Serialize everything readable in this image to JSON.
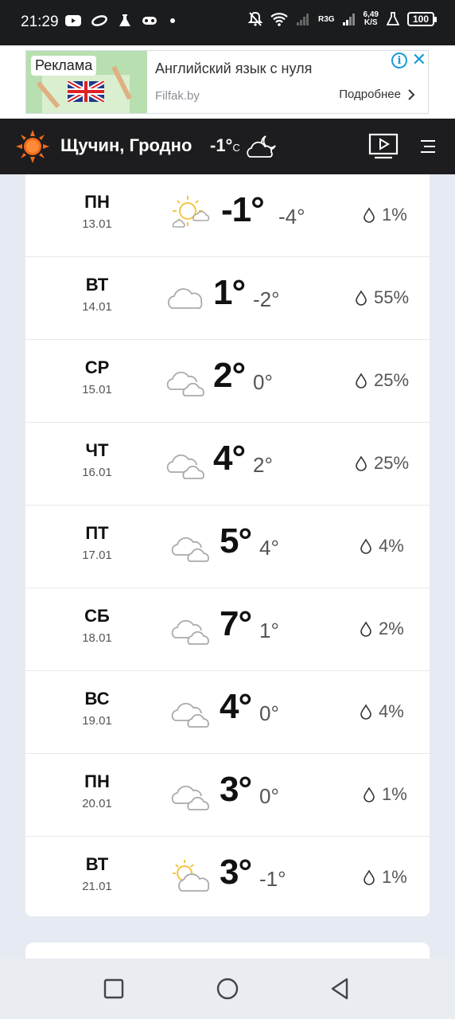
{
  "status_bar": {
    "time": "21:29",
    "network_tag": "R3G",
    "net_speed_value": "6,49",
    "net_speed_unit": "K/S",
    "battery": "100"
  },
  "ad": {
    "badge": "Реклама",
    "title": "Английский язык с нуля",
    "domain": "Filfak.by",
    "more_label": "Подробнее",
    "info_symbol": "i",
    "close_symbol": "✕"
  },
  "header": {
    "city": "Щучин, Гродно",
    "current_temp": "-1°",
    "current_unit": "C",
    "current_icon": "cloudy-night-icon",
    "accent_color": "#f26b1d"
  },
  "forecast": [
    {
      "day": "ПН",
      "date": "13.01",
      "icon": "sun-cloud-icon",
      "max": "-1°",
      "min": "-4°",
      "precip": "1%"
    },
    {
      "day": "ВТ",
      "date": "14.01",
      "icon": "cloud-icon",
      "max": "1°",
      "min": "-2°",
      "precip": "55%"
    },
    {
      "day": "СР",
      "date": "15.01",
      "icon": "clouds-icon",
      "max": "2°",
      "min": "0°",
      "precip": "25%"
    },
    {
      "day": "ЧТ",
      "date": "16.01",
      "icon": "clouds-icon",
      "max": "4°",
      "min": "2°",
      "precip": "25%"
    },
    {
      "day": "ПТ",
      "date": "17.01",
      "icon": "clouds-icon",
      "max": "5°",
      "min": "4°",
      "precip": "4%"
    },
    {
      "day": "СБ",
      "date": "18.01",
      "icon": "clouds-icon",
      "max": "7°",
      "min": "1°",
      "precip": "2%"
    },
    {
      "day": "ВС",
      "date": "19.01",
      "icon": "clouds-icon",
      "max": "4°",
      "min": "0°",
      "precip": "4%"
    },
    {
      "day": "ПН",
      "date": "20.01",
      "icon": "clouds-icon",
      "max": "3°",
      "min": "0°",
      "precip": "1%"
    },
    {
      "day": "ВТ",
      "date": "21.01",
      "icon": "partly-cloudy-icon",
      "max": "3°",
      "min": "-1°",
      "precip": "1%"
    }
  ]
}
